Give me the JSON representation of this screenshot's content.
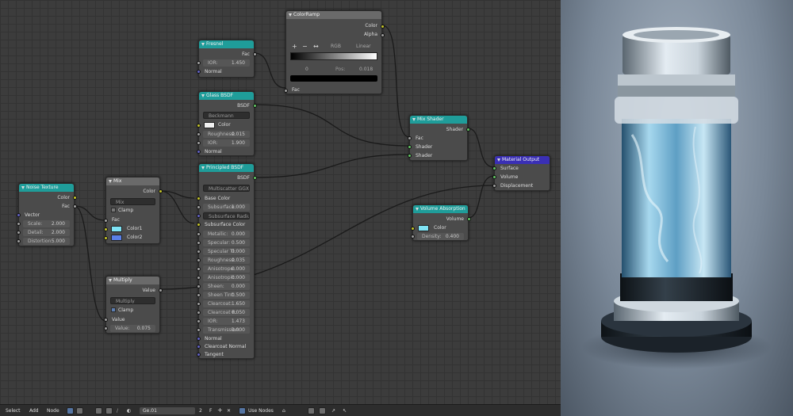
{
  "nodes": {
    "colorramp": {
      "title": "ColorRamp",
      "out_color": "Color",
      "out_alpha": "Alpha",
      "btn_add": "+",
      "btn_remove": "−",
      "btn_flip": "↔",
      "mode": "RGB",
      "interp": "Linear",
      "index": "0",
      "pos_label": "Pos:",
      "pos_value": "0.018",
      "in_fac": "Fac"
    },
    "fresnel": {
      "title": "Fresnel",
      "out_fac": "Fac",
      "ior_label": "IOR:",
      "ior_value": "1.450",
      "in_normal": "Normal"
    },
    "glass": {
      "title": "Glass BSDF",
      "out_bsdf": "BSDF",
      "distribution": "Beckmann",
      "color_label": "Color",
      "color_value": "#f2f2f2",
      "roughness_label": "Roughness:",
      "roughness_value": "0.015",
      "ior_label": "IOR:",
      "ior_value": "1.900",
      "in_normal": "Normal"
    },
    "mixshader": {
      "title": "Mix Shader",
      "out_shader": "Shader",
      "in_fac": "Fac",
      "in_shader1": "Shader",
      "in_shader2": "Shader"
    },
    "output": {
      "title": "Material Output",
      "in_surface": "Surface",
      "in_volume": "Volume",
      "in_displacement": "Displacement"
    },
    "noise": {
      "title": "Noise Texture",
      "out_color": "Color",
      "out_fac": "Fac",
      "in_vector": "Vector",
      "fields": [
        {
          "label": "Scale:",
          "value": "2.000"
        },
        {
          "label": "Detail:",
          "value": "2.000"
        },
        {
          "label": "Distortion:",
          "value": "5.000"
        }
      ]
    },
    "mix": {
      "title": "Mix",
      "out_color": "Color",
      "blend": "Mix",
      "clamp_label": "Clamp",
      "in_fac": "Fac",
      "color1_label": "Color1",
      "color1_value": "#7fe3f5",
      "color2_label": "Color2",
      "color2_value": "#5a7fe6"
    },
    "multiply": {
      "title": "Multiply",
      "out_value": "Value",
      "operation": "Multiply",
      "clamp_label": "Clamp",
      "in_value": "Value",
      "value_label": "Value:",
      "value_value": "0.075"
    },
    "principled": {
      "title": "Principled BSDF",
      "out_bsdf": "BSDF",
      "distribution": "Multiscatter GGX",
      "in_base_color": "Base Color",
      "subsurface_label": "Subsurface:",
      "subsurface_value": "1.000",
      "subsurface_radius": "Subsurface Radius",
      "in_subsurface_color": "Subsurface Color",
      "fields": [
        {
          "label": "Metallic:",
          "value": "0.000"
        },
        {
          "label": "Specular:",
          "value": "0.500"
        },
        {
          "label": "Specular Ti:",
          "value": "0.000"
        },
        {
          "label": "Roughness:",
          "value": "0.035"
        },
        {
          "label": "Anisotrope:",
          "value": "0.000"
        },
        {
          "label": "Anisotropic:",
          "value": "0.000"
        },
        {
          "label": "Sheen:",
          "value": "0.000"
        },
        {
          "label": "Sheen Tint:",
          "value": "0.500"
        },
        {
          "label": "Clearcoat:",
          "value": "1.650"
        },
        {
          "label": "Clearcoat R:",
          "value": "0.050"
        },
        {
          "label": "IOR:",
          "value": "1.473"
        },
        {
          "label": "Transmission:",
          "value": "0.000"
        }
      ],
      "in_normal": "Normal",
      "in_clearcoat_normal": "Clearcoat Normal",
      "in_tangent": "Tangent"
    },
    "volume": {
      "title": "Volume Absorption",
      "out_volume": "Volume",
      "color_label": "Color",
      "color_value": "#7fe3f5",
      "density_label": "Density:",
      "density_value": "0.400"
    }
  },
  "header": {
    "menu": [
      "Select",
      "Add",
      "Node"
    ],
    "material_name": "Ge.01",
    "users": "2",
    "use_nodes_label": "Use Nodes"
  },
  "colors": {
    "input_header": "#d1453b",
    "texture_header": "#c65a2e",
    "shader_header": "#27a29c",
    "converter_header": "#3c7fd1",
    "output_header": "#7a2f2f",
    "color_socket": "#c7c729",
    "shader_socket": "#63c763",
    "value_socket": "#a1a1a1",
    "vector_socket": "#6363c7"
  }
}
